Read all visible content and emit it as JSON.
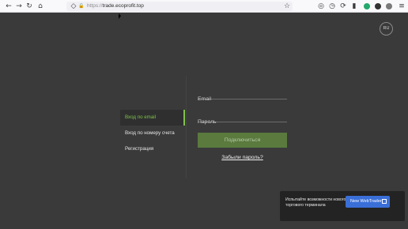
{
  "browser": {
    "url_protocol": "https://",
    "url_host": "trade.ecoprofit.top",
    "icons": {
      "back": "←",
      "forward": "→",
      "reload": "↻",
      "home": "⌂",
      "shield": "◇",
      "lock": "🔒",
      "star": "☆",
      "pocket": "◎",
      "history": "◷",
      "sync": "⟳",
      "bar": "▮",
      "menu": "≡"
    },
    "badge_colors": {
      "ext1": "#24a86b",
      "ext2": "#333333",
      "ext3": "#7a7a7a"
    }
  },
  "page": {
    "lang_button": "RU",
    "menu": [
      {
        "label": "Вход по email",
        "active": true
      },
      {
        "label": "Вход по номеру счета",
        "active": false
      },
      {
        "label": "Регистрация",
        "active": false
      }
    ],
    "email_placeholder": "Email",
    "password_placeholder": "Пароль",
    "submit_label": "Подключиться",
    "forgot_label": "Забыли пароль?",
    "promo_text": "Испытайте возможности нового торгового терминала",
    "promo_button": "New WebTrader",
    "accent_color": "#7fc24a",
    "button_color": "#5a7a3e"
  }
}
